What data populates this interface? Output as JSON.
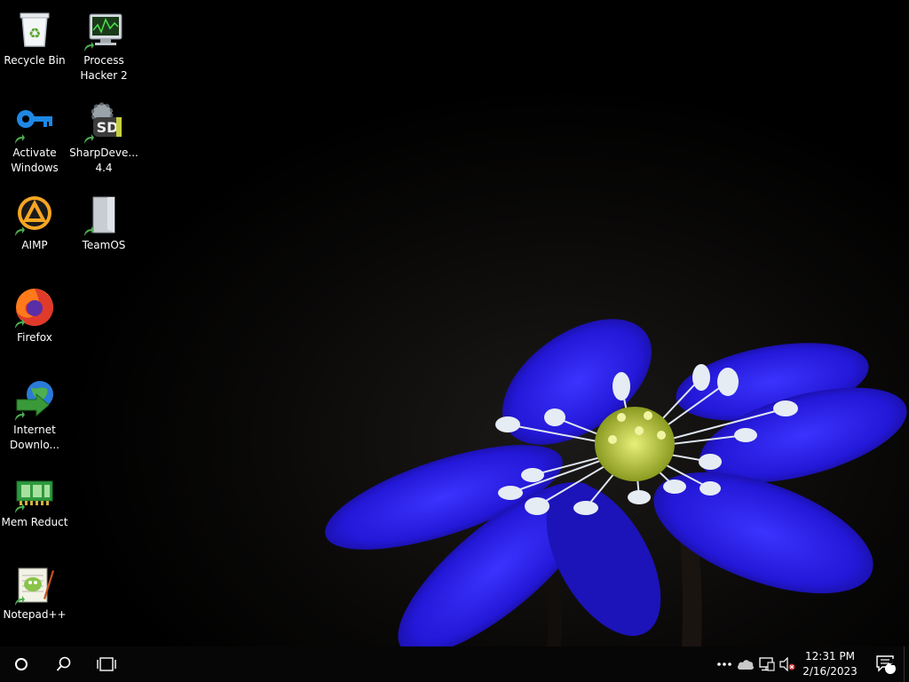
{
  "desktop": {
    "icons": [
      {
        "label": "Recycle Bin",
        "icon": "recycle-bin-icon"
      },
      {
        "label": "Process\nHacker 2",
        "icon": "process-hacker-icon"
      },
      {
        "label": "Activate\nWindows",
        "icon": "key-icon"
      },
      {
        "label": "SharpDeve...\n4.4",
        "icon": "sharpdevelop-icon"
      },
      {
        "label": "AIMP",
        "icon": "aimp-icon"
      },
      {
        "label": "TeamOS",
        "icon": "teamos-icon"
      },
      {
        "label": "Firefox",
        "icon": "firefox-icon"
      },
      {
        "label": "Internet\nDownlo...",
        "icon": "internet-download-manager-icon"
      },
      {
        "label": "Mem Reduct",
        "icon": "mem-reduct-icon"
      },
      {
        "label": "Notepad++",
        "icon": "notepad-plus-plus-icon"
      }
    ]
  },
  "taskbar": {
    "start_icon": "start-circle-icon",
    "search_icon": "search-icon",
    "task_view_icon": "task-view-icon",
    "tray": {
      "overflow_icon": "more-dots-icon",
      "onedrive_icon": "cloud-icon",
      "network_icon": "network-icon",
      "volume_icon": "volume-muted-icon"
    },
    "clock": {
      "time": "12:31 PM",
      "date": "2/16/2023"
    },
    "notifications": {
      "icon": "action-center-icon",
      "count": "1"
    }
  },
  "colors": {
    "taskbar_bg": "#060606",
    "flower_blue": "#2a1fe0",
    "stamen_yellow": "#c8d83a"
  }
}
